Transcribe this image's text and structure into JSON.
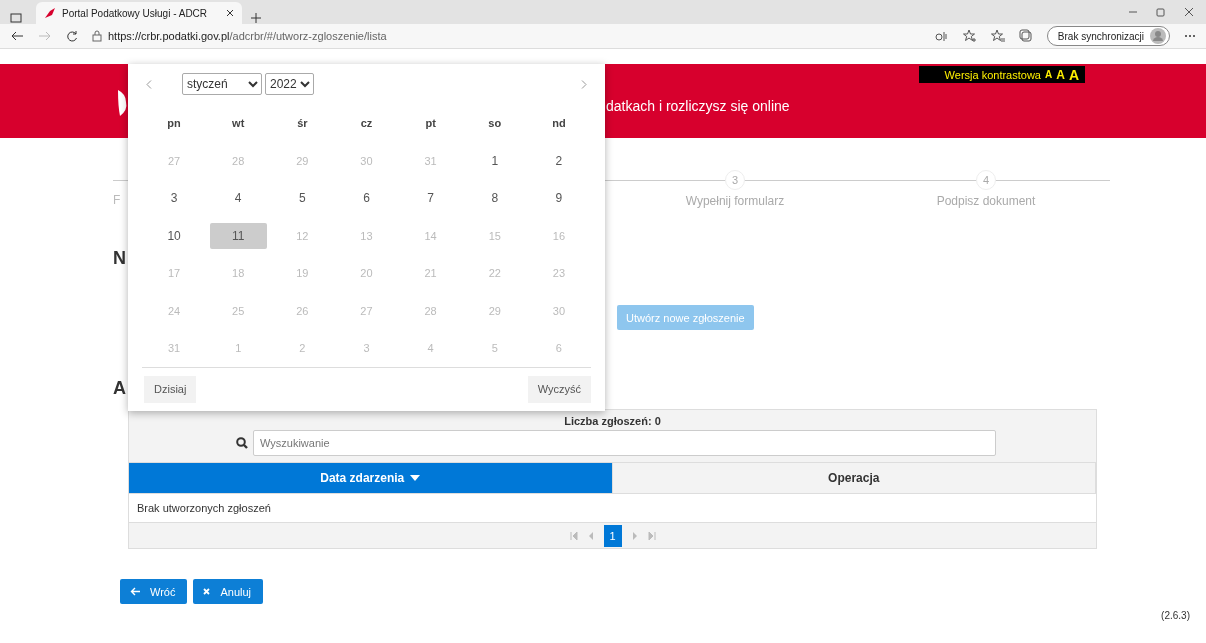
{
  "browser": {
    "tab_title": "Portal Podatkowy Usługi - ADCR",
    "url_host": "https://crbr.podatki.gov.pl",
    "url_path": "/adcrbr/#/utworz-zgloszenie/lista",
    "sync_button": "Brak synchronizacji"
  },
  "header": {
    "contrast_link": "Wersja kontrastowa",
    "font_sizes": [
      "A",
      "A",
      "A"
    ],
    "tagline": "datkach i rozliczysz się online"
  },
  "stepper": {
    "first_label_fragment": "F",
    "steps": [
      {
        "number": "3",
        "label": "Wypełnij formularz"
      },
      {
        "number": "4",
        "label": "Podpisz dokument"
      }
    ]
  },
  "content": {
    "heading_fragment": "N",
    "create_button": {
      "label": "Utwórz nowe zgłoszenie",
      "disabled": true
    },
    "list_heading_fragment": "A"
  },
  "table": {
    "count": "Liczba zgłoszeń: 0",
    "search_placeholder": "Wyszukiwanie",
    "columns": [
      {
        "label": "Data zdarzenia",
        "sorted": true
      },
      {
        "label": "Operacja",
        "sorted": false
      }
    ],
    "empty_text": "Brak utworzonych zgłoszeń",
    "pages": [
      {
        "label": "1",
        "selected": true
      }
    ]
  },
  "buttons": [
    {
      "kind": "back",
      "label": "Wróć"
    },
    {
      "kind": "cancel",
      "label": "Anuluj"
    }
  ],
  "version": "(2.6.3)",
  "calendar": {
    "month": "styczeń",
    "year": "2022",
    "weekdays": [
      "pn",
      "wt",
      "śr",
      "cz",
      "pt",
      "so",
      "nd"
    ],
    "weeks": [
      [
        {
          "day": "27",
          "disabled": true,
          "selected": false
        },
        {
          "day": "28",
          "disabled": true,
          "selected": false
        },
        {
          "day": "29",
          "disabled": true,
          "selected": false
        },
        {
          "day": "30",
          "disabled": true,
          "selected": false
        },
        {
          "day": "31",
          "disabled": true,
          "selected": false
        },
        {
          "day": "1",
          "disabled": false,
          "selected": false
        },
        {
          "day": "2",
          "disabled": false,
          "selected": false
        }
      ],
      [
        {
          "day": "3",
          "disabled": false,
          "selected": false
        },
        {
          "day": "4",
          "disabled": false,
          "selected": false
        },
        {
          "day": "5",
          "disabled": false,
          "selected": false
        },
        {
          "day": "6",
          "disabled": false,
          "selected": false
        },
        {
          "day": "7",
          "disabled": false,
          "selected": false
        },
        {
          "day": "8",
          "disabled": false,
          "selected": false
        },
        {
          "day": "9",
          "disabled": false,
          "selected": false
        }
      ],
      [
        {
          "day": "10",
          "disabled": false,
          "selected": false
        },
        {
          "day": "11",
          "disabled": false,
          "selected": true
        },
        {
          "day": "12",
          "disabled": true,
          "selected": false
        },
        {
          "day": "13",
          "disabled": true,
          "selected": false
        },
        {
          "day": "14",
          "disabled": true,
          "selected": false
        },
        {
          "day": "15",
          "disabled": true,
          "selected": false
        },
        {
          "day": "16",
          "disabled": true,
          "selected": false
        }
      ],
      [
        {
          "day": "17",
          "disabled": true,
          "selected": false
        },
        {
          "day": "18",
          "disabled": true,
          "selected": false
        },
        {
          "day": "19",
          "disabled": true,
          "selected": false
        },
        {
          "day": "20",
          "disabled": true,
          "selected": false
        },
        {
          "day": "21",
          "disabled": true,
          "selected": false
        },
        {
          "day": "22",
          "disabled": true,
          "selected": false
        },
        {
          "day": "23",
          "disabled": true,
          "selected": false
        }
      ],
      [
        {
          "day": "24",
          "disabled": true,
          "selected": false
        },
        {
          "day": "25",
          "disabled": true,
          "selected": false
        },
        {
          "day": "26",
          "disabled": true,
          "selected": false
        },
        {
          "day": "27",
          "disabled": true,
          "selected": false
        },
        {
          "day": "28",
          "disabled": true,
          "selected": false
        },
        {
          "day": "29",
          "disabled": true,
          "selected": false
        },
        {
          "day": "30",
          "disabled": true,
          "selected": false
        }
      ],
      [
        {
          "day": "31",
          "disabled": true,
          "selected": false
        },
        {
          "day": "1",
          "disabled": true,
          "selected": false
        },
        {
          "day": "2",
          "disabled": true,
          "selected": false
        },
        {
          "day": "3",
          "disabled": true,
          "selected": false
        },
        {
          "day": "4",
          "disabled": true,
          "selected": false
        },
        {
          "day": "5",
          "disabled": true,
          "selected": false
        },
        {
          "day": "6",
          "disabled": true,
          "selected": false
        }
      ]
    ],
    "today_button": "Dzisiaj",
    "clear_button": "Wyczyść"
  }
}
